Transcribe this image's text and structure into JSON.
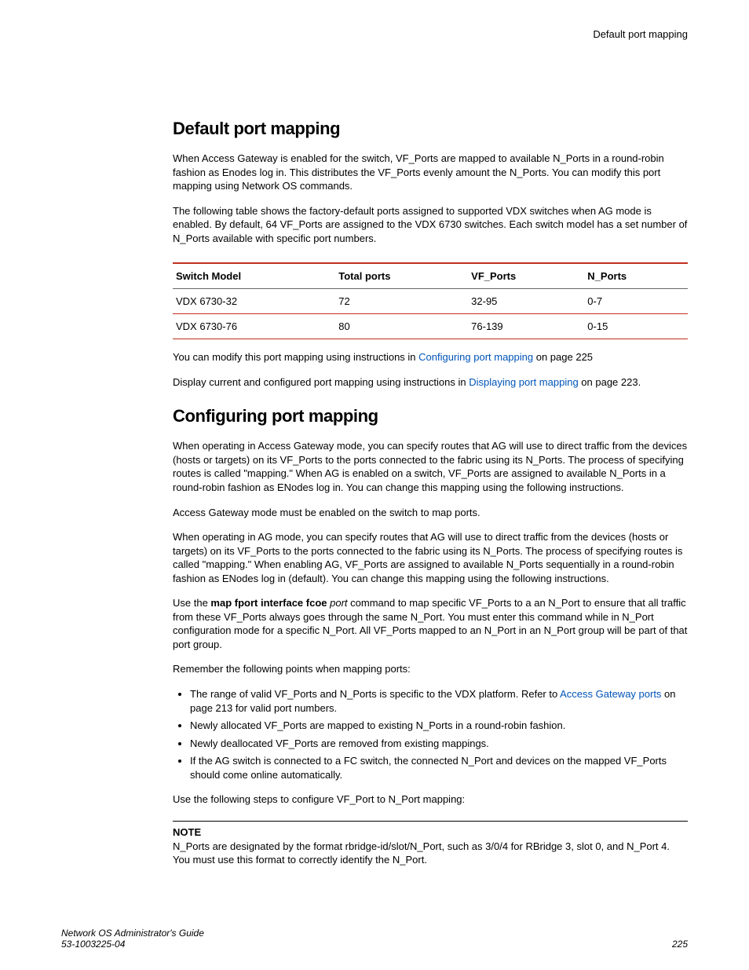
{
  "header": {
    "running": "Default port mapping"
  },
  "h1_a": "Default port mapping",
  "p1": "When Access Gateway is enabled for the switch, VF_Ports are mapped to available N_Ports in a round-robin fashion as Enodes log in. This distributes the VF_Ports evenly amount the N_Ports. You can modify this port mapping using Network OS commands.",
  "p2": "The following table shows the factory-default ports assigned to supported VDX switches when AG mode is enabled. By default, 64 VF_Ports are assigned to the VDX 6730 switches. Each switch model has a set number of N_Ports available with specific port numbers.",
  "table": {
    "cols": [
      "Switch Model",
      "Total ports",
      "VF_Ports",
      "N_Ports"
    ],
    "rows": [
      [
        "VDX 6730-32",
        "72",
        "32-95",
        "0-7"
      ],
      [
        "VDX 6730-76",
        "80",
        "76-139",
        "0-15"
      ]
    ]
  },
  "p3a": "You can modify this port mapping using instructions in ",
  "p3link": "Configuring port mapping",
  "p3b": " on page 225",
  "p4a": "Display current and configured port mapping using instructions in ",
  "p4link": "Displaying port mapping",
  "p4b": " on page 223.",
  "h1_b": "Configuring port mapping",
  "p5": "When operating in Access Gateway mode, you can specify routes that AG will use to direct traffic from the devices (hosts or targets) on its VF_Ports to the ports connected to the fabric using its N_Ports. The process of specifying routes is called \"mapping.\" When AG is enabled on a switch, VF_Ports are assigned to available N_Ports in a round-robin fashion as ENodes log in. You can change this mapping using the following instructions.",
  "p6": "Access Gateway mode must be enabled on the switch to map ports.",
  "p7": "When operating in AG mode, you can specify routes that AG will use to direct traffic from the devices (hosts or targets) on its VF_Ports to the ports connected to the fabric using its N_Ports. The process of specifying routes is called \"mapping.\" When enabling AG, VF_Ports are assigned to available N_Ports sequentially in a round-robin fashion as ENodes log in (default). You can change this mapping using the following instructions.",
  "p8a": "Use the ",
  "p8bold": "map fport interface fcoe",
  "p8ital": " port",
  "p8b": " command to map specific VF_Ports to a an N_Port to ensure that all traffic from these VF_Ports always goes through the same N_Port. You must enter this command while in N_Port configuration mode for a specific N_Port. All VF_Ports mapped to an N_Port in an N_Port group will be part of that port group.",
  "p9": "Remember the following points when mapping ports:",
  "bullets": {
    "b1a": "The range of valid VF_Ports and N_Ports is specific to the VDX platform. Refer to ",
    "b1link": "Access Gateway ports",
    "b1b": " on page 213 for valid port numbers.",
    "b2": "Newly allocated VF_Ports are mapped to existing N_Ports in a round-robin fashion.",
    "b3": "Newly deallocated VF_Ports are removed from existing mappings.",
    "b4": "If the AG switch is connected to a FC switch, the connected N_Port and devices on the mapped VF_Ports should come online automatically."
  },
  "p10": "Use the following steps to configure VF_Port to N_Port mapping:",
  "note": {
    "head": "NOTE",
    "body": "N_Ports are designated by the format rbridge-id/slot/N_Port, such as 3/0/4 for RBridge 3, slot 0, and N_Port 4. You must use this format to correctly identify the N_Port."
  },
  "footer": {
    "left1": "Network OS Administrator's Guide",
    "left2": "53-1003225-04",
    "right": "225"
  }
}
